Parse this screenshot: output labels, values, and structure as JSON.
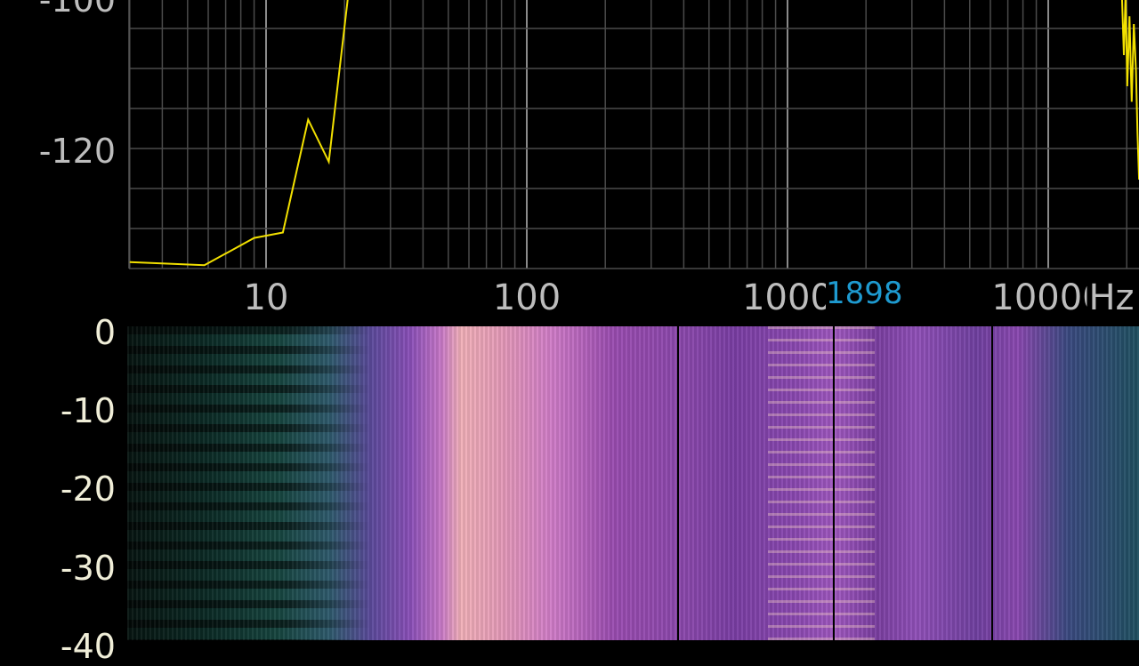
{
  "spectrum": {
    "y_labels": [
      {
        "value": -100,
        "text": "-100"
      },
      {
        "value": -120,
        "text": "-120"
      }
    ],
    "x_labels": [
      {
        "value": 10,
        "text": "10"
      },
      {
        "value": 100,
        "text": "100"
      },
      {
        "value": 1000,
        "text": "1000"
      },
      {
        "value": 10000,
        "text": "10000"
      }
    ],
    "unit": "Hz",
    "cursor_freq": "1898",
    "line_color": "#f2e000",
    "cursor_color": "#1e9ad0",
    "x_range_hz": [
      3,
      22300
    ],
    "y_range_db": [
      -135,
      -99
    ],
    "trace": [
      [
        3,
        -134.6
      ],
      [
        5.8,
        -135
      ],
      [
        9,
        -131.5
      ],
      [
        11.6,
        -130.8
      ],
      [
        14.5,
        -116.3
      ],
      [
        17.4,
        -121.7
      ],
      [
        20.7,
        -100
      ],
      [
        23,
        -90
      ],
      [
        19000,
        -90
      ],
      [
        19200,
        -101
      ],
      [
        19500,
        -108
      ],
      [
        19800,
        -100
      ],
      [
        20100,
        -112
      ],
      [
        20500,
        -103
      ],
      [
        20900,
        -114
      ],
      [
        21300,
        -104
      ],
      [
        21700,
        -110
      ],
      [
        22000,
        -118
      ],
      [
        22300,
        -124
      ]
    ]
  },
  "spectrogram": {
    "time_labels": [
      "0",
      "-10",
      "-20",
      "-30",
      "-40"
    ]
  }
}
